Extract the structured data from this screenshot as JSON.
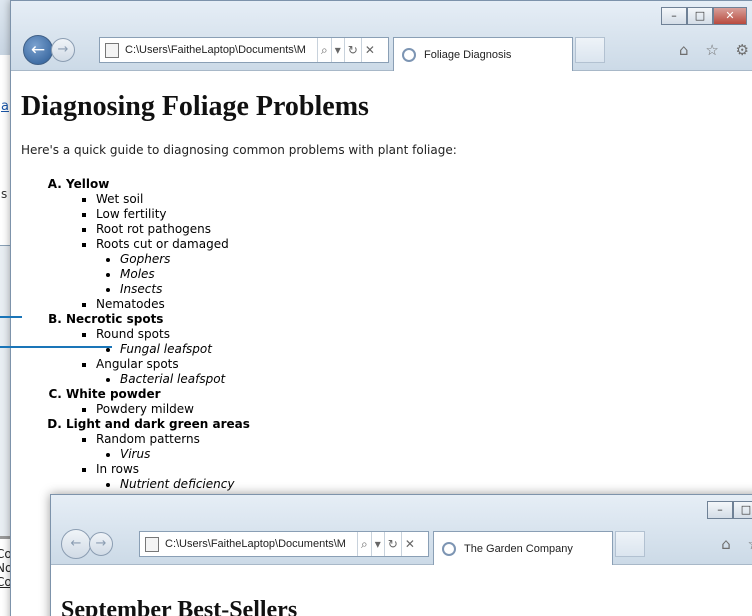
{
  "background_window": {
    "left_snippet_link": "a",
    "left_snippet_text": "s",
    "footer_lines": [
      "Cop",
      "No r",
      "Con"
    ]
  },
  "main_window": {
    "caption": {
      "minimize": "–",
      "maximize": "□",
      "close": "✕"
    },
    "nav": {
      "back_icon": "←",
      "forward_icon": "→"
    },
    "address": {
      "url": "C:\\Users\\FaitheLaptop\\Documents\\M",
      "search_icon": "⌕",
      "dropdown_icon": "▾",
      "refresh_icon": "↻",
      "stop_icon": "✕"
    },
    "tab_title": "Foliage Diagnosis",
    "right_tools": "⌂ ☆ ⚙",
    "page": {
      "heading": "Diagnosing Foliage Problems",
      "intro": "Here's a quick guide to diagnosing common problems with plant foliage:",
      "problems": [
        {
          "label": "Yellow",
          "causes": [
            {
              "label": "Wet soil",
              "details": []
            },
            {
              "label": "Low fertility",
              "details": []
            },
            {
              "label": "Root rot pathogens",
              "details": []
            },
            {
              "label": "Roots cut or damaged",
              "details": [
                "Gophers",
                "Moles",
                "Insects"
              ]
            },
            {
              "label": "Nematodes",
              "details": []
            }
          ]
        },
        {
          "label": "Necrotic spots",
          "causes": [
            {
              "label": "Round spots",
              "details": [
                "Fungal leafspot"
              ]
            },
            {
              "label": "Angular spots",
              "details": [
                "Bacterial leafspot"
              ]
            }
          ]
        },
        {
          "label": "White powder",
          "causes": [
            {
              "label": "Powdery mildew",
              "details": []
            }
          ]
        },
        {
          "label": "Light and dark green areas",
          "causes": [
            {
              "label": "Random patterns",
              "details": [
                "Virus"
              ]
            },
            {
              "label": "In rows",
              "details": [
                "Nutrient deficiency"
              ]
            }
          ]
        }
      ]
    }
  },
  "second_window": {
    "caption": {
      "minimize": "–",
      "maximize": "□"
    },
    "nav": {
      "back_icon": "←",
      "forward_icon": "→"
    },
    "address": {
      "url": "C:\\Users\\FaitheLaptop\\Documents\\M",
      "search_icon": "⌕",
      "dropdown_icon": "▾",
      "refresh_icon": "↻",
      "stop_icon": "✕"
    },
    "tab_title": "The Garden Company",
    "right_tools": "⌂ ☆",
    "page": {
      "heading": "September Best-Sellers"
    }
  },
  "colors": {
    "callout": "#1a75b8",
    "link": "#1a56a8"
  }
}
